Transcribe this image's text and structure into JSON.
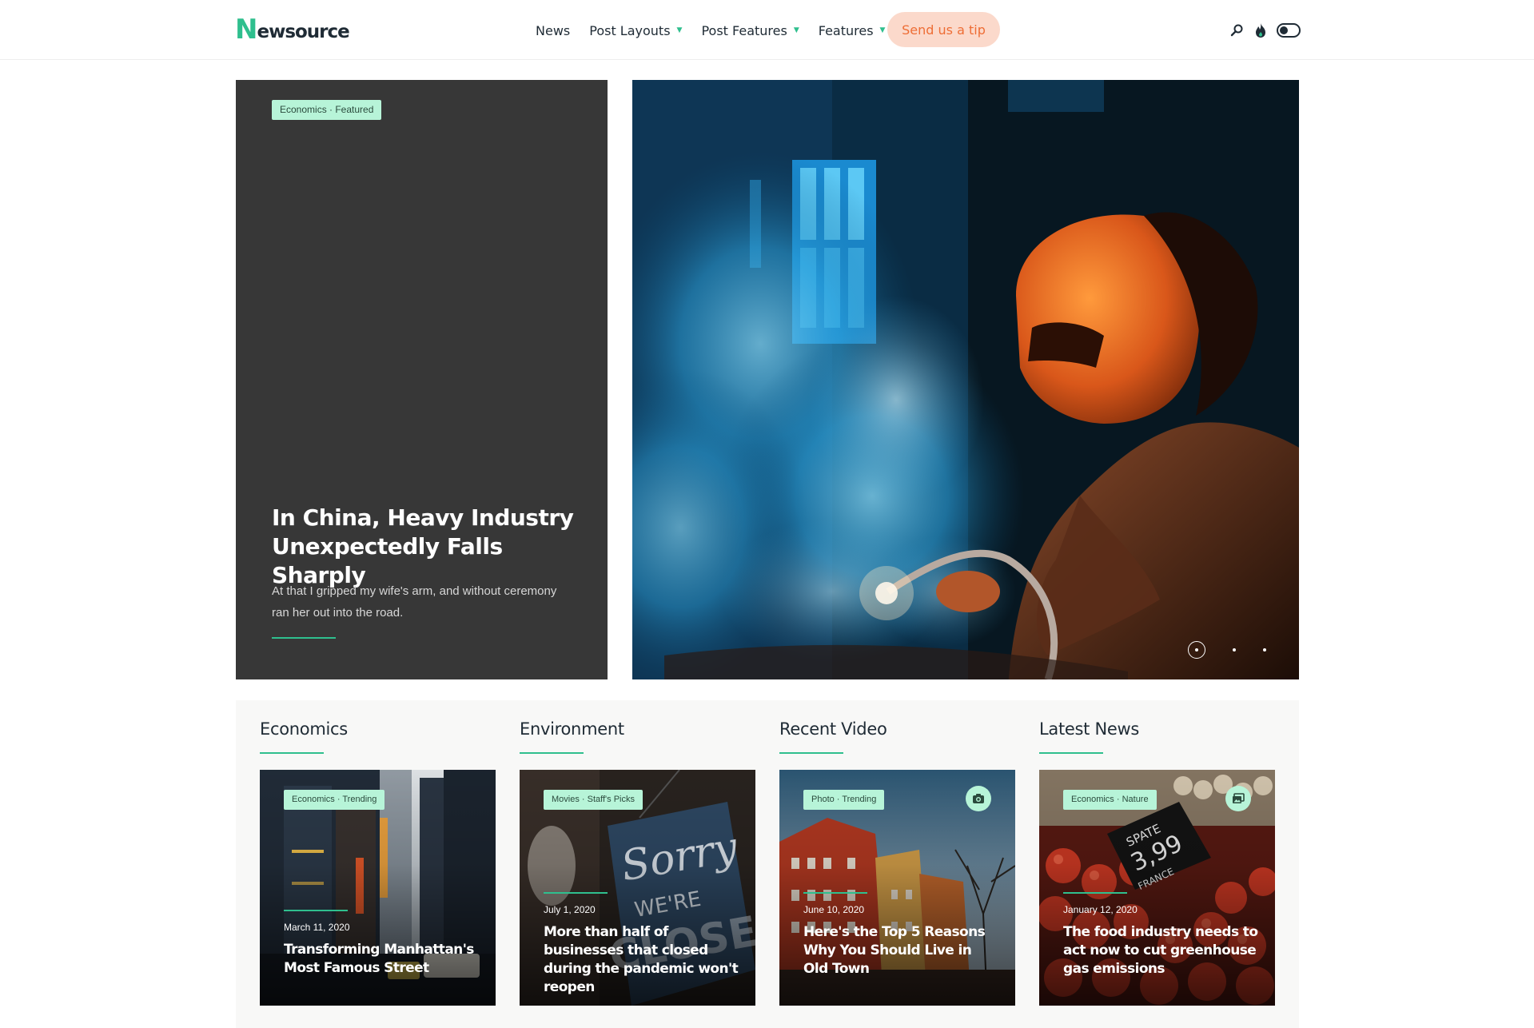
{
  "header": {
    "logo_first": "N",
    "logo_rest": "ewsource",
    "nav": [
      {
        "label": "News"
      },
      {
        "label": "Post Layouts"
      },
      {
        "label": "Post Features"
      },
      {
        "label": "Features"
      }
    ],
    "tip_button": "Send us a tip",
    "icons": [
      "search-icon",
      "flame-icon",
      "dark-mode-toggle"
    ]
  },
  "hero": {
    "tag": "Economics · Featured",
    "title": "In China, Heavy Industry Unexpectedly Falls Sharply",
    "excerpt": "At that I gripped my wife's arm, and without ceremony ran her out into the road.",
    "image": "welder-with-smoke",
    "slides": 3,
    "active_slide": 1
  },
  "sections": [
    {
      "title": "Economics",
      "card": {
        "tag": "Economics · Trending",
        "date": "March 11, 2020",
        "title": "Transforming Manhattan's Most Famous Street",
        "media_icon": ""
      }
    },
    {
      "title": "Environment",
      "card": {
        "tag": "Movies · Staff's Picks",
        "date": "July 1, 2020",
        "title": "More than half of businesses that closed during the pandemic won't reopen",
        "media_icon": ""
      }
    },
    {
      "title": "Recent Video",
      "card": {
        "tag": "Photo · Trending",
        "date": "June 10, 2020",
        "title": "Here's the Top 5 Reasons Why You Should Live in Old Town",
        "media_icon": "camera-icon"
      }
    },
    {
      "title": "Latest News",
      "card": {
        "tag": "Economics · Nature",
        "date": "January 12, 2020",
        "title": "The food industry needs to act now to cut greenhouse gas emissions",
        "media_icon": "gallery-icon"
      }
    }
  ],
  "colors": {
    "accent": "#2fbf8e",
    "tag_bg": "#b7f4d8",
    "tip_bg": "#fbd9cb",
    "tip_text": "#ee6d35",
    "hero_panel": "#373737"
  }
}
